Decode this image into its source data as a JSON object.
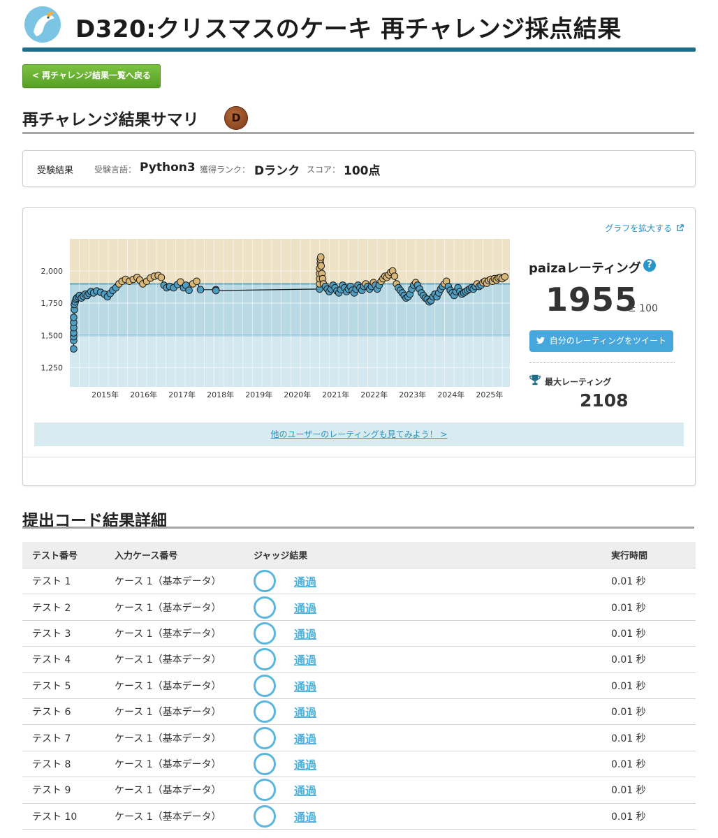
{
  "header": {
    "title": "D320:クリスマスのケーキ 再チャレンジ採点結果",
    "logo_icon": "bird-logo-icon"
  },
  "nav": {
    "back_label": "< 再チャレンジ結果一覧へ戻る"
  },
  "summary": {
    "heading": "再チャレンジ結果サマリ",
    "rank_badge": "D"
  },
  "result": {
    "label": "受験結果",
    "language_label": "受験言語：",
    "language": "Python3",
    "rank_label": "獲得ランク：",
    "rank": "Dランク",
    "score_label": "スコア：",
    "score": "100点"
  },
  "rating": {
    "expand_link": "グラフを拡大する",
    "label": "paizaレーティング",
    "value": "1955",
    "pm": "± 100",
    "tweet_label": "自分のレーティングをツイート",
    "max_label": "最大レーティング",
    "max_value": "2108",
    "others_link": "他のユーザーのレーティングも見てみよう！ >"
  },
  "chart_data": {
    "type": "scatter",
    "x_tick_labels": [
      "2015年",
      "2016年",
      "2017年",
      "2018年",
      "2019年",
      "2020年",
      "2021年",
      "2022年",
      "2023年",
      "2024年",
      "2025年"
    ],
    "y_tick_labels": [
      "2,000",
      "1,750",
      "1,500",
      "1,250"
    ],
    "y_ticks": [
      2000,
      1750,
      1500,
      1250
    ],
    "ylim": [
      1100,
      2250
    ],
    "xlim": [
      2014.5,
      2025.95
    ],
    "band_colors": {
      "above_1900": "#ede2c6",
      "1500_1900": "#b9dae4",
      "below_1500": "#d4e9ef"
    },
    "points": [
      [
        2014.6,
        1395
      ],
      [
        2014.6,
        1460
      ],
      [
        2014.6,
        1490
      ],
      [
        2014.6,
        1520
      ],
      [
        2014.6,
        1560
      ],
      [
        2014.6,
        1600
      ],
      [
        2014.6,
        1640
      ],
      [
        2014.62,
        1700
      ],
      [
        2014.62,
        1740
      ],
      [
        2014.64,
        1760
      ],
      [
        2014.66,
        1780
      ],
      [
        2014.68,
        1790
      ],
      [
        2014.72,
        1800
      ],
      [
        2014.75,
        1810
      ],
      [
        2014.8,
        1790
      ],
      [
        2014.85,
        1805
      ],
      [
        2014.9,
        1820
      ],
      [
        2014.95,
        1810
      ],
      [
        2015.0,
        1825
      ],
      [
        2015.05,
        1840
      ],
      [
        2015.12,
        1830
      ],
      [
        2015.2,
        1845
      ],
      [
        2015.3,
        1835
      ],
      [
        2015.4,
        1820
      ],
      [
        2015.48,
        1800
      ],
      [
        2015.55,
        1825
      ],
      [
        2015.62,
        1850
      ],
      [
        2015.7,
        1870
      ],
      [
        2015.78,
        1900
      ],
      [
        2015.86,
        1920
      ],
      [
        2015.95,
        1935
      ],
      [
        2016.05,
        1920
      ],
      [
        2016.15,
        1935
      ],
      [
        2016.25,
        1950
      ],
      [
        2016.32,
        1930
      ],
      [
        2016.4,
        1900
      ],
      [
        2016.5,
        1920
      ],
      [
        2016.6,
        1945
      ],
      [
        2016.7,
        1960
      ],
      [
        2016.8,
        1965
      ],
      [
        2016.88,
        1950
      ],
      [
        2016.95,
        1890
      ],
      [
        2017.02,
        1870
      ],
      [
        2017.1,
        1880
      ],
      [
        2017.2,
        1870
      ],
      [
        2017.3,
        1895
      ],
      [
        2017.38,
        1915
      ],
      [
        2017.46,
        1870
      ],
      [
        2017.52,
        1890
      ],
      [
        2017.6,
        1850
      ],
      [
        2017.7,
        1900
      ],
      [
        2017.8,
        1920
      ],
      [
        2017.9,
        1855
      ],
      [
        2018.3,
        1855
      ],
      [
        2018.3,
        1848
      ],
      [
        2021.0,
        1860
      ],
      [
        2021.0,
        1900
      ],
      [
        2021.0,
        1940
      ],
      [
        2021.0,
        1980
      ],
      [
        2021.0,
        2020
      ],
      [
        2021.02,
        2060
      ],
      [
        2021.02,
        2090
      ],
      [
        2021.03,
        2108
      ],
      [
        2021.04,
        2040
      ],
      [
        2021.06,
        1980
      ],
      [
        2021.08,
        1940
      ],
      [
        2021.1,
        1900
      ],
      [
        2021.15,
        1880
      ],
      [
        2021.2,
        1860
      ],
      [
        2021.25,
        1840
      ],
      [
        2021.3,
        1860
      ],
      [
        2021.35,
        1890
      ],
      [
        2021.4,
        1870
      ],
      [
        2021.45,
        1845
      ],
      [
        2021.5,
        1830
      ],
      [
        2021.55,
        1855
      ],
      [
        2021.6,
        1890
      ],
      [
        2021.65,
        1870
      ],
      [
        2021.7,
        1840
      ],
      [
        2021.75,
        1860
      ],
      [
        2021.8,
        1880
      ],
      [
        2021.85,
        1850
      ],
      [
        2021.9,
        1830
      ],
      [
        2021.95,
        1860
      ],
      [
        2022.0,
        1890
      ],
      [
        2022.05,
        1870
      ],
      [
        2022.1,
        1850
      ],
      [
        2022.15,
        1880
      ],
      [
        2022.2,
        1900
      ],
      [
        2022.25,
        1880
      ],
      [
        2022.3,
        1860
      ],
      [
        2022.35,
        1880
      ],
      [
        2022.4,
        1910
      ],
      [
        2022.45,
        1890
      ],
      [
        2022.5,
        1860
      ],
      [
        2022.55,
        1890
      ],
      [
        2022.6,
        1920
      ],
      [
        2022.65,
        1940
      ],
      [
        2022.7,
        1960
      ],
      [
        2022.75,
        1950
      ],
      [
        2022.8,
        1970
      ],
      [
        2022.85,
        1990
      ],
      [
        2022.9,
        2000
      ],
      [
        2022.95,
        1960
      ],
      [
        2023.0,
        1900
      ],
      [
        2023.05,
        1870
      ],
      [
        2023.1,
        1850
      ],
      [
        2023.15,
        1830
      ],
      [
        2023.2,
        1810
      ],
      [
        2023.25,
        1790
      ],
      [
        2023.3,
        1800
      ],
      [
        2023.35,
        1820
      ],
      [
        2023.4,
        1860
      ],
      [
        2023.45,
        1890
      ],
      [
        2023.5,
        1910
      ],
      [
        2023.55,
        1890
      ],
      [
        2023.6,
        1860
      ],
      [
        2023.65,
        1830
      ],
      [
        2023.7,
        1810
      ],
      [
        2023.75,
        1790
      ],
      [
        2023.8,
        1780
      ],
      [
        2023.85,
        1760
      ],
      [
        2023.9,
        1770
      ],
      [
        2023.95,
        1800
      ],
      [
        2024.0,
        1820
      ],
      [
        2024.05,
        1800
      ],
      [
        2024.1,
        1830
      ],
      [
        2024.15,
        1860
      ],
      [
        2024.2,
        1880
      ],
      [
        2024.25,
        1900
      ],
      [
        2024.3,
        1920
      ],
      [
        2024.35,
        1880
      ],
      [
        2024.4,
        1850
      ],
      [
        2024.45,
        1830
      ],
      [
        2024.5,
        1810
      ],
      [
        2024.55,
        1840
      ],
      [
        2024.6,
        1870
      ],
      [
        2024.65,
        1840
      ],
      [
        2024.7,
        1820
      ],
      [
        2024.75,
        1830
      ],
      [
        2024.8,
        1840
      ],
      [
        2024.85,
        1850
      ],
      [
        2024.9,
        1860
      ],
      [
        2024.95,
        1870
      ],
      [
        2025.0,
        1860
      ],
      [
        2025.05,
        1880
      ],
      [
        2025.1,
        1900
      ],
      [
        2025.15,
        1880
      ],
      [
        2025.2,
        1890
      ],
      [
        2025.25,
        1910
      ],
      [
        2025.3,
        1920
      ],
      [
        2025.35,
        1905
      ],
      [
        2025.4,
        1925
      ],
      [
        2025.45,
        1935
      ],
      [
        2025.5,
        1920
      ],
      [
        2025.55,
        1940
      ],
      [
        2025.6,
        1930
      ],
      [
        2025.65,
        1945
      ],
      [
        2025.7,
        1950
      ],
      [
        2025.75,
        1940
      ],
      [
        2025.82,
        1955
      ]
    ]
  },
  "detail": {
    "heading": "提出コード結果詳細",
    "columns": [
      "テスト番号",
      "入力ケース番号",
      "ジャッジ結果",
      "実行時間"
    ],
    "rows": [
      {
        "test": "テスト 1",
        "case": "ケース 1（基本データ）",
        "judge": "通過",
        "time": "0.01 秒"
      },
      {
        "test": "テスト 2",
        "case": "ケース 1（基本データ）",
        "judge": "通過",
        "time": "0.01 秒"
      },
      {
        "test": "テスト 3",
        "case": "ケース 1（基本データ）",
        "judge": "通過",
        "time": "0.01 秒"
      },
      {
        "test": "テスト 4",
        "case": "ケース 1（基本データ）",
        "judge": "通過",
        "time": "0.01 秒"
      },
      {
        "test": "テスト 5",
        "case": "ケース 1（基本データ）",
        "judge": "通過",
        "time": "0.01 秒"
      },
      {
        "test": "テスト 6",
        "case": "ケース 1（基本データ）",
        "judge": "通過",
        "time": "0.01 秒"
      },
      {
        "test": "テスト 7",
        "case": "ケース 1（基本データ）",
        "judge": "通過",
        "time": "0.01 秒"
      },
      {
        "test": "テスト 8",
        "case": "ケース 1（基本データ）",
        "judge": "通過",
        "time": "0.01 秒"
      },
      {
        "test": "テスト 9",
        "case": "ケース 1（基本データ）",
        "judge": "通過",
        "time": "0.01 秒"
      },
      {
        "test": "テスト 10",
        "case": "ケース 1（基本データ）",
        "judge": "通過",
        "time": "0.01 秒"
      }
    ]
  }
}
